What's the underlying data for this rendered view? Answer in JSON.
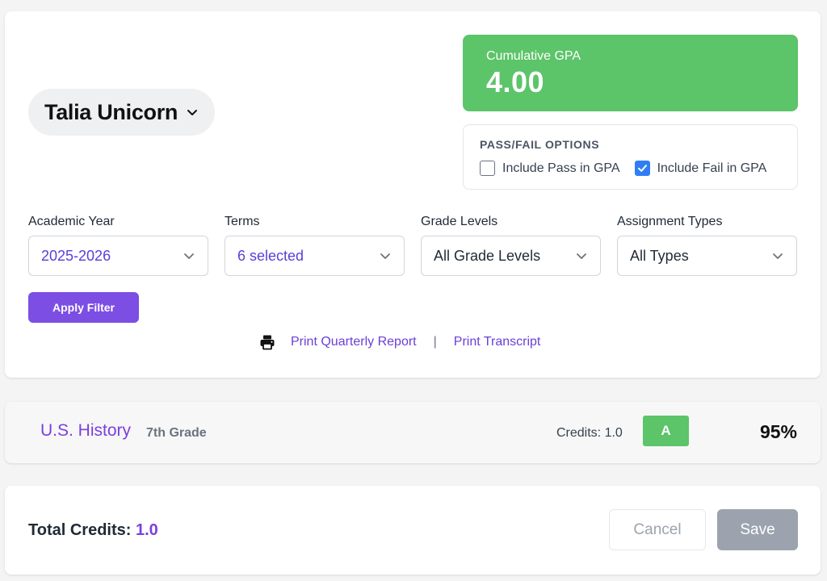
{
  "student": {
    "name": "Talia Unicorn"
  },
  "gpa": {
    "label": "Cumulative GPA",
    "value": "4.00",
    "color": "#5cc469"
  },
  "pass_fail": {
    "title": "PASS/FAIL OPTIONS",
    "options": [
      {
        "label": "Include Pass in GPA",
        "checked": false
      },
      {
        "label": "Include Fail in GPA",
        "checked": true
      }
    ]
  },
  "filters": [
    {
      "label": "Academic Year",
      "value": "2025-2026"
    },
    {
      "label": "Terms",
      "value": "6 selected"
    },
    {
      "label": "Grade Levels",
      "value": "All Grade Levels"
    },
    {
      "label": "Assignment Types",
      "value": "All Types"
    }
  ],
  "apply_filter_label": "Apply Filter",
  "print": {
    "icon": "printer-icon",
    "quarterly_label": "Print Quarterly Report",
    "separator": "|",
    "transcript_label": "Print Transcript"
  },
  "course": {
    "name": "U.S. History",
    "grade_level": "7th Grade",
    "credits_label": "Credits: 1.0",
    "letter_grade": "A",
    "percent": "95%"
  },
  "footer": {
    "total_credits_label": "Total Credits:",
    "total_credits_value": "1.0",
    "cancel_label": "Cancel",
    "save_label": "Save"
  },
  "colors": {
    "accent": "#7c4ee4",
    "success": "#5cc469",
    "checkbox": "#2f7ef5"
  }
}
